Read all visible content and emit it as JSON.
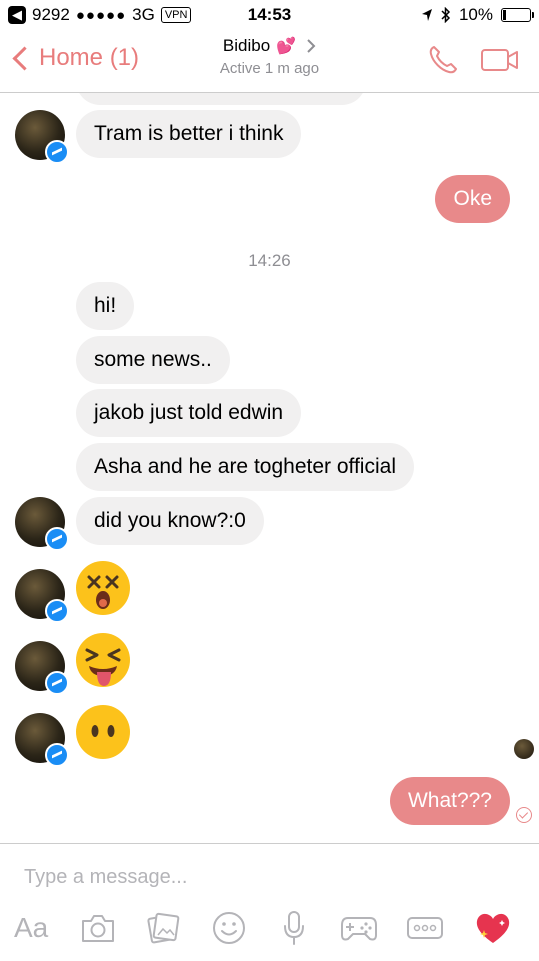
{
  "status_bar": {
    "carrier": "9292",
    "signal_dots": "●●●●●",
    "network": "3G",
    "vpn": "VPN",
    "time": "14:53",
    "battery_percent": "10%",
    "battery_level": 0.1
  },
  "nav": {
    "back_label": "Home (1)",
    "title": "Bidibo",
    "title_emoji": "💕",
    "subtitle": "Active 1 m ago"
  },
  "messages": {
    "m1": "Tram is better i think",
    "m2": "Oke",
    "timestamp": "14:26",
    "m3": "hi!",
    "m4": "some news..",
    "m5": "jakob just told edwin",
    "m6": "Asha and he are togheter official",
    "m7": "did you know?:0",
    "m8": "What???"
  },
  "emojis": [
    "dizzy-face",
    "squinting-tongue-face",
    "face-without-mouth"
  ],
  "composer": {
    "placeholder": "Type a message...",
    "aa_label": "Aa"
  },
  "colors": {
    "accent": "#e8898a",
    "incoming_bubble": "#f1f0f0",
    "messenger_blue": "#1a8df5",
    "gray_text": "#8e8e93"
  }
}
